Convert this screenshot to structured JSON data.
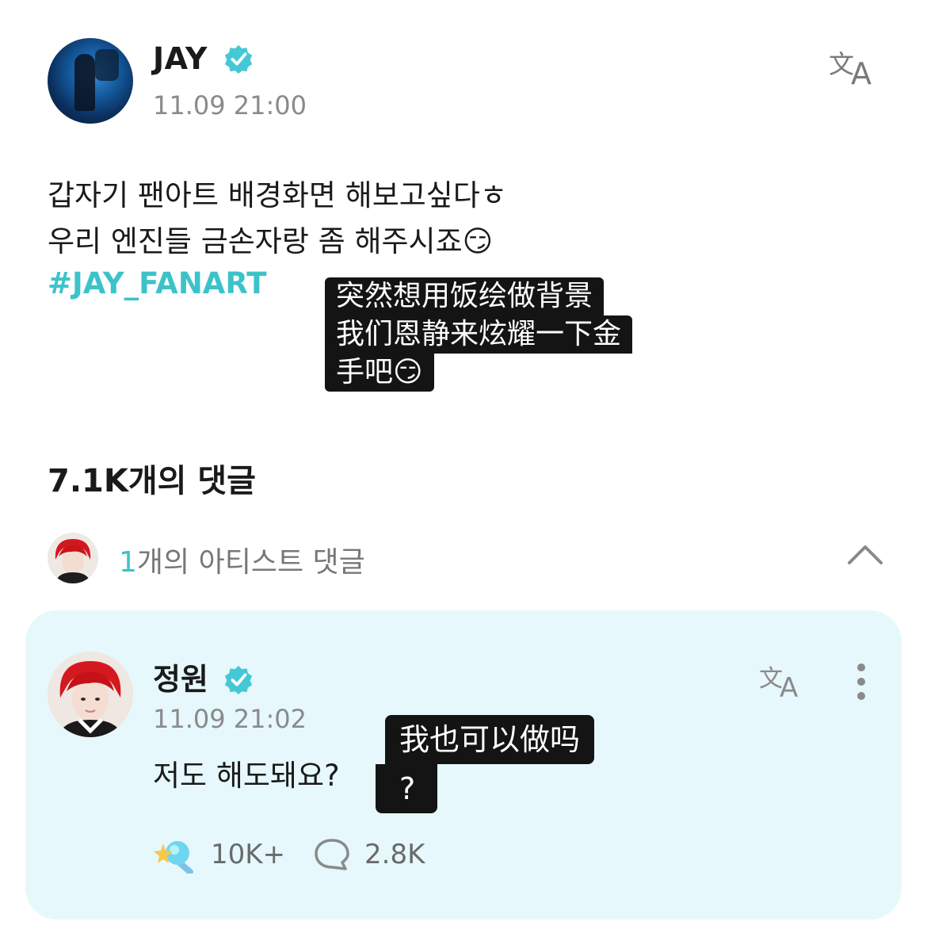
{
  "post": {
    "author": "JAY",
    "timestamp": "11.09 21:00",
    "body_line1": "갑자기 팬아트 배경화면 해보고싶다ㅎ",
    "body_line2": "우리 엔진들 금손자랑 좀 해주시죠😏",
    "hashtag": "#JAY_FANART",
    "subtitle_line1": "突然想用饭绘做背景",
    "subtitle_line2": "我们恩静来炫耀一下金",
    "subtitle_line3": "手吧😏"
  },
  "comments": {
    "title": "7.1K개의 댓글",
    "artist_count": "1",
    "artist_label": "개의 아티스트 댓글"
  },
  "artist_comment": {
    "author": "정원",
    "timestamp": "11.09 21:02",
    "text": "저도 해도돼요?",
    "subtitle_line1": "我也可以做吗",
    "subtitle_line2": "?",
    "likes": "10K+",
    "replies": "2.8K"
  },
  "icons": {
    "verified": "verified-badge-icon",
    "translate": "translate-icon",
    "more": "more-vertical-icon",
    "chevron": "chevron-up-icon",
    "like": "sparkle-lightstick-icon",
    "reply": "speech-bubble-icon"
  },
  "colors": {
    "accent": "#3cc3c9",
    "card_bg": "#e6f8fb",
    "subtitle_bg": "#141414"
  }
}
